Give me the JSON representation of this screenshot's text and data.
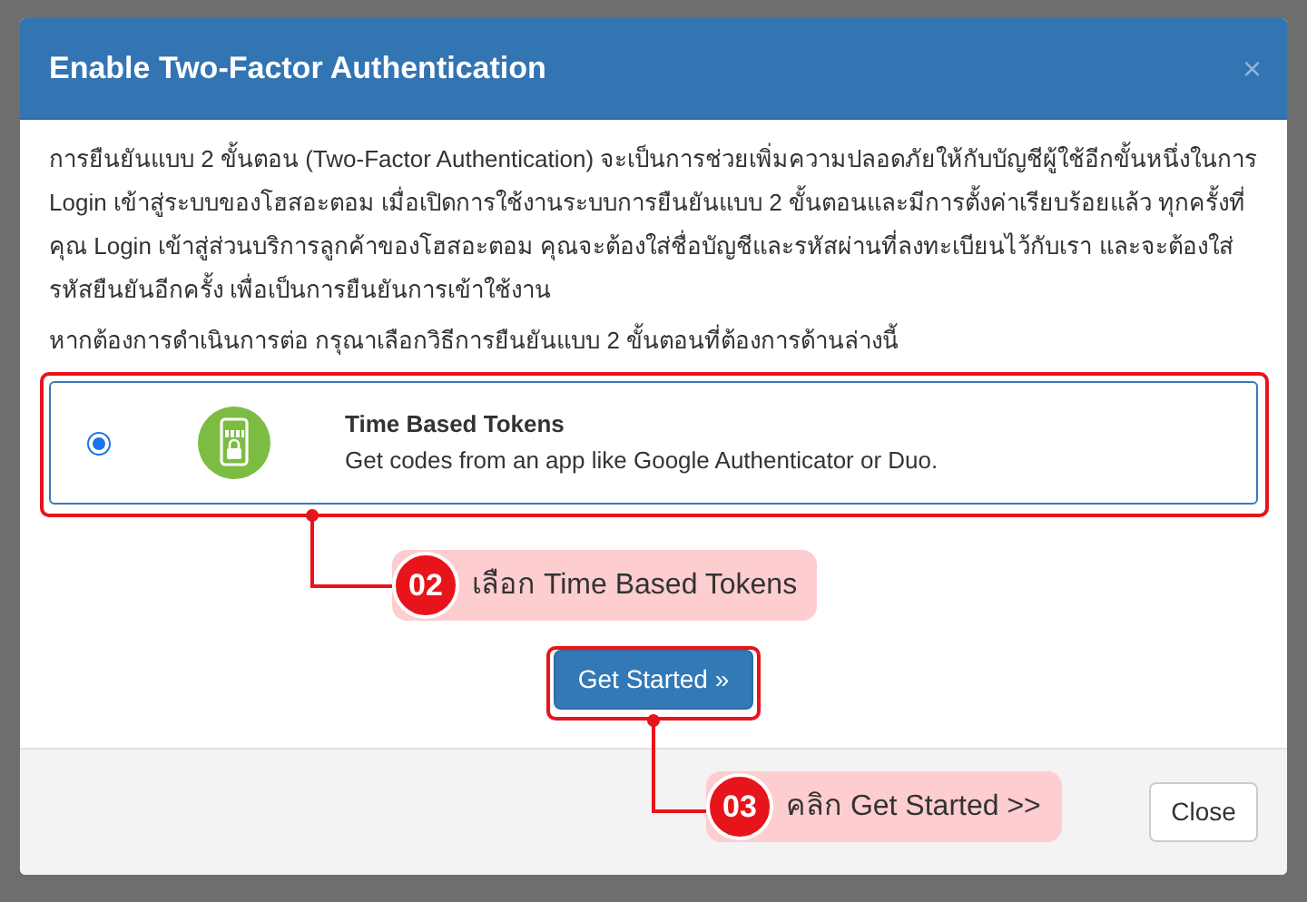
{
  "modal": {
    "title": "Enable Two-Factor Authentication",
    "close_glyph": "×",
    "intro": "การยืนยันแบบ 2 ขั้นตอน (Two-Factor Authentication) จะเป็นการช่วยเพิ่มความปลอดภัยให้กับบัญชีผู้ใช้อีกขั้นหนึ่งในการ Login เข้าสู่ระบบของโฮสอะตอม เมื่อเปิดการใช้งานระบบการยืนยันแบบ 2 ขั้นตอนและมีการตั้งค่าเรียบร้อยแล้ว ทุกครั้งที่คุณ Login เข้าสู่ส่วนบริการลูกค้าของโฮสอะตอม คุณจะต้องใส่ชื่อบัญชีและรหัสผ่านที่ลงทะเบียนไว้กับเรา และจะต้องใส่รหัสยืนยันอีกครั้ง เพื่อเป็นการยืนยันการเข้าใช้งาน",
    "prompt": "หากต้องการดำเนินการต่อ กรุณาเลือกวิธีการยืนยันแบบ 2 ขั้นตอนที่ต้องการด้านล่างนี้",
    "options": [
      {
        "title": "Time Based Tokens",
        "description": "Get codes from an app like Google Authenticator or Duo.",
        "selected": true
      }
    ],
    "primary_button": "Get Started »",
    "footer_button": "Close"
  },
  "annotations": [
    {
      "number": "02",
      "text": "เลือก Time Based Tokens"
    },
    {
      "number": "03",
      "text": "คลิก Get Started >>"
    }
  ]
}
